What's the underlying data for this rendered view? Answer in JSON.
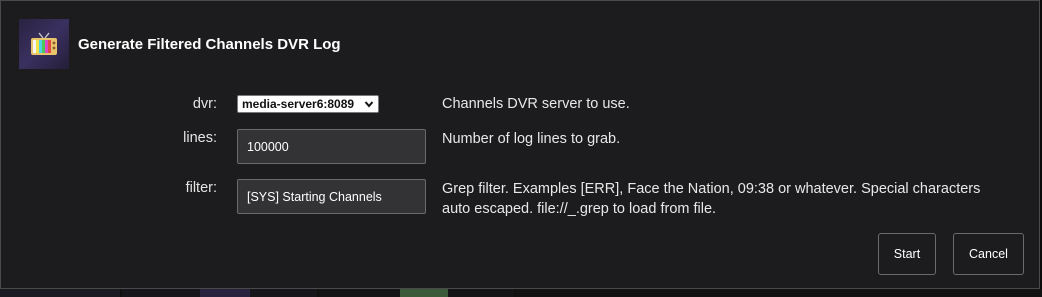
{
  "dialog": {
    "title": "Generate Filtered Channels DVR Log",
    "app_icon": "retro-tv-icon"
  },
  "fields": {
    "dvr": {
      "label": "dvr:",
      "selected": "media-server6:8089",
      "help": "Channels DVR server to use."
    },
    "lines": {
      "label": "lines:",
      "value": "100000",
      "help": "Number of log lines to grab."
    },
    "filter": {
      "label": "filter:",
      "value": "[SYS] Starting Channels",
      "help": "Grep filter. Examples [ERR], Face the Nation, 09:38 or whatever. Special characters auto escaped. file://_.grep to load from file."
    }
  },
  "buttons": {
    "start": "Start",
    "cancel": "Cancel"
  },
  "colors": {
    "dialog_bg": "#1c1c1e",
    "input_bg": "#333335",
    "border": "#6a6a6a",
    "text": "#e8e8e8"
  }
}
